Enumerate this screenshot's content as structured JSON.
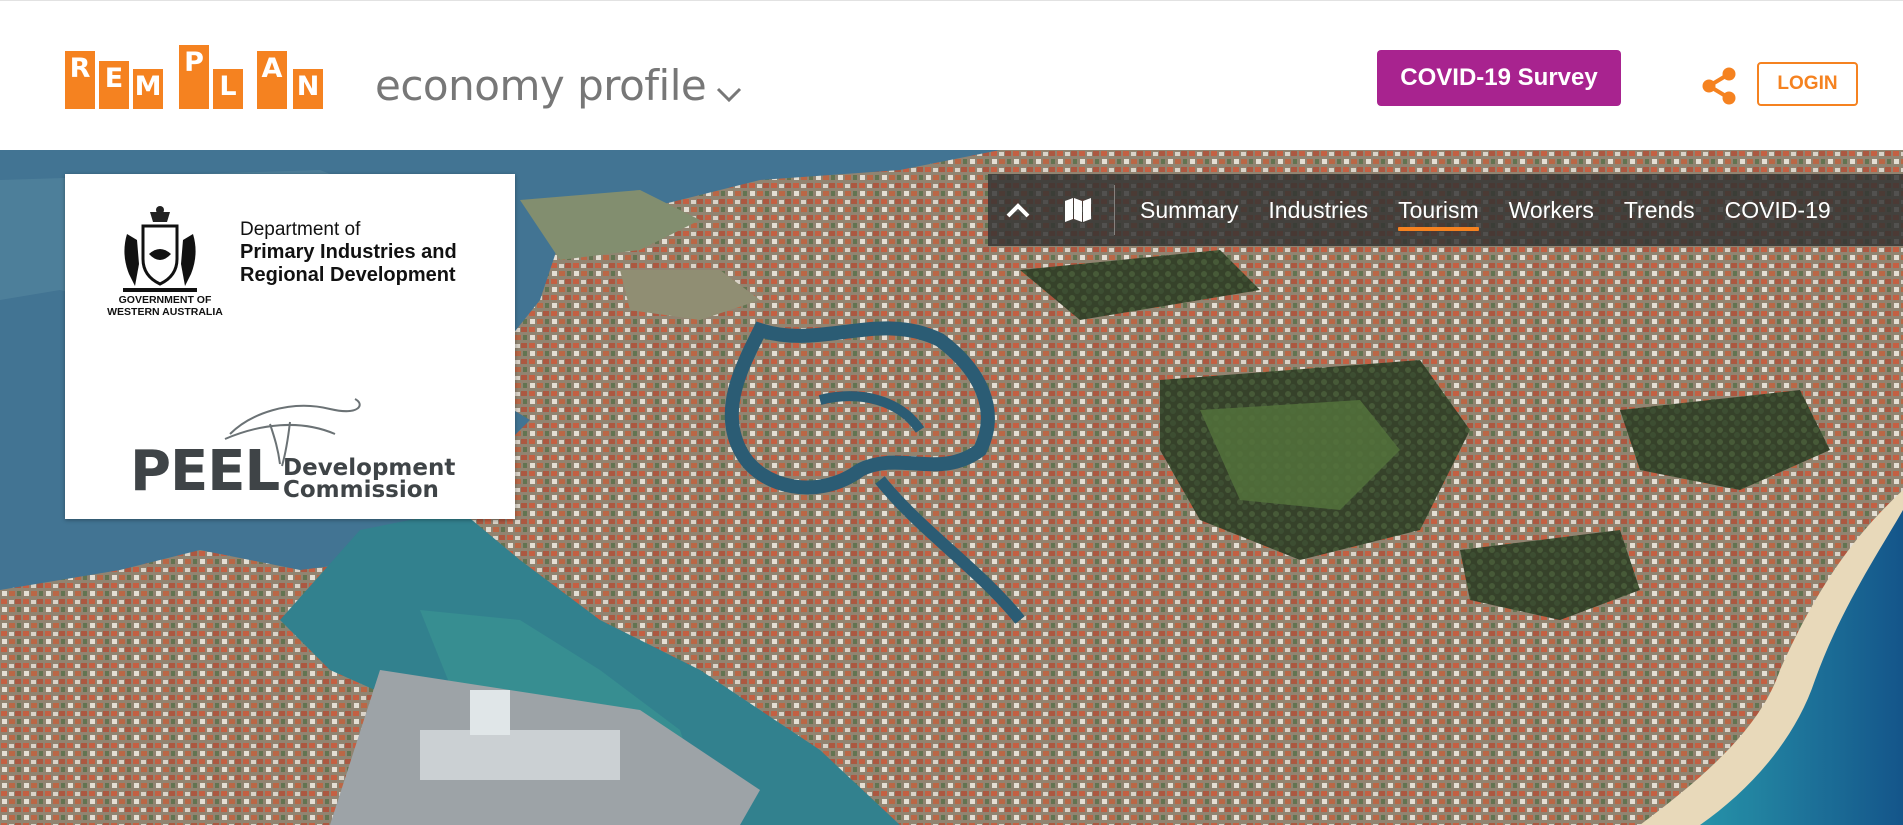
{
  "brand": {
    "logo_letters": [
      "R",
      "E",
      "M",
      "P",
      "L",
      "A",
      "N"
    ],
    "product_name": "economy profile",
    "accent_color": "#f58220"
  },
  "header": {
    "covid_survey_label": "COVID-19 Survey",
    "covid_survey_color": "#a8238f",
    "share_icon": "share-icon",
    "login_label": "LOGIN"
  },
  "partner": {
    "gov_line1": "GOVERNMENT OF",
    "gov_line2": "WESTERN AUSTRALIA",
    "dept_line1": "Department of",
    "dept_line2": "Primary Industries and",
    "dept_line3": "Regional Development",
    "peel_word": "PEEL",
    "peel_sub1": "Development",
    "peel_sub2": "Commission"
  },
  "nav": {
    "collapse_icon": "chevron-up-icon",
    "map_icon": "map-icon",
    "tabs": [
      {
        "label": "Summary",
        "active": false
      },
      {
        "label": "Industries",
        "active": false
      },
      {
        "label": "Tourism",
        "active": true
      },
      {
        "label": "Workers",
        "active": false
      },
      {
        "label": "Trends",
        "active": false
      },
      {
        "label": "COVID-19",
        "active": false
      }
    ]
  }
}
